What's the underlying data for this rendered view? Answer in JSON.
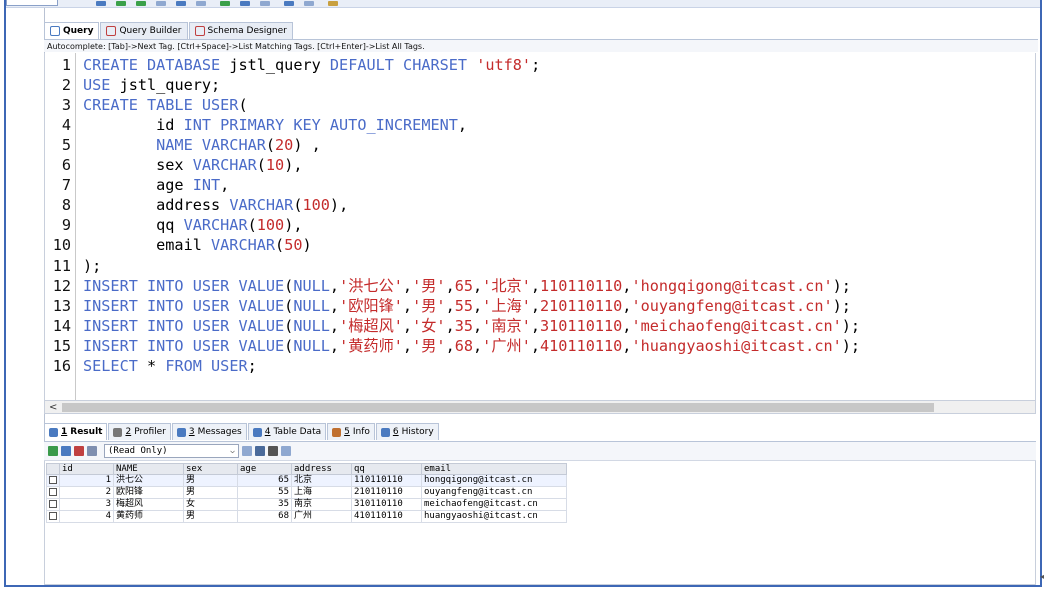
{
  "top_strip": {
    "db_selector_value": ""
  },
  "editor_tabs": [
    {
      "label": "Query",
      "icon": "query-icon",
      "active": true
    },
    {
      "label": "Query Builder",
      "icon": "query-builder-icon",
      "active": false
    },
    {
      "label": "Schema Designer",
      "icon": "schema-designer-icon",
      "active": false
    }
  ],
  "autocomplete_hint": "Autocomplete: [Tab]->Next Tag. [Ctrl+Space]->List Matching Tags. [Ctrl+Enter]->List All Tags.",
  "code_lines": [
    {
      "num": "1",
      "segments": [
        {
          "t": "kw",
          "v": "CREATE DATABASE "
        },
        {
          "t": "tx",
          "v": "jstl_query "
        },
        {
          "t": "kw",
          "v": "DEFAULT CHARSET "
        },
        {
          "t": "str",
          "v": "'utf8'"
        },
        {
          "t": "tx",
          "v": ";"
        }
      ]
    },
    {
      "num": "2",
      "segments": [
        {
          "t": "kw",
          "v": "USE "
        },
        {
          "t": "tx",
          "v": "jstl_query;"
        }
      ]
    },
    {
      "num": "3",
      "segments": [
        {
          "t": "kw",
          "v": "CREATE TABLE USER"
        },
        {
          "t": "tx",
          "v": "("
        }
      ]
    },
    {
      "num": "4",
      "segments": [
        {
          "t": "tx",
          "v": "        id "
        },
        {
          "t": "kw",
          "v": "INT PRIMARY KEY AUTO_INCREMENT"
        },
        {
          "t": "tx",
          "v": ","
        }
      ]
    },
    {
      "num": "5",
      "segments": [
        {
          "t": "kw",
          "v": "        NAME VARCHAR"
        },
        {
          "t": "tx",
          "v": "("
        },
        {
          "t": "str",
          "v": "20"
        },
        {
          "t": "tx",
          "v": ") ,"
        }
      ]
    },
    {
      "num": "6",
      "segments": [
        {
          "t": "tx",
          "v": "        sex "
        },
        {
          "t": "kw",
          "v": "VARCHAR"
        },
        {
          "t": "tx",
          "v": "("
        },
        {
          "t": "str",
          "v": "10"
        },
        {
          "t": "tx",
          "v": "),"
        }
      ]
    },
    {
      "num": "7",
      "segments": [
        {
          "t": "tx",
          "v": "        age "
        },
        {
          "t": "kw",
          "v": "INT"
        },
        {
          "t": "tx",
          "v": ","
        }
      ]
    },
    {
      "num": "8",
      "segments": [
        {
          "t": "tx",
          "v": "        address "
        },
        {
          "t": "kw",
          "v": "VARCHAR"
        },
        {
          "t": "tx",
          "v": "("
        },
        {
          "t": "str",
          "v": "100"
        },
        {
          "t": "tx",
          "v": "),"
        }
      ]
    },
    {
      "num": "9",
      "segments": [
        {
          "t": "tx",
          "v": "        qq "
        },
        {
          "t": "kw",
          "v": "VARCHAR"
        },
        {
          "t": "tx",
          "v": "("
        },
        {
          "t": "str",
          "v": "100"
        },
        {
          "t": "tx",
          "v": "),"
        }
      ]
    },
    {
      "num": "10",
      "segments": [
        {
          "t": "tx",
          "v": "        email "
        },
        {
          "t": "kw",
          "v": "VARCHAR"
        },
        {
          "t": "tx",
          "v": "("
        },
        {
          "t": "str",
          "v": "50"
        },
        {
          "t": "tx",
          "v": ")"
        }
      ]
    },
    {
      "num": "11",
      "segments": [
        {
          "t": "tx",
          "v": ");"
        }
      ]
    },
    {
      "num": "12",
      "segments": [
        {
          "t": "kw",
          "v": "INSERT INTO USER VALUE"
        },
        {
          "t": "tx",
          "v": "("
        },
        {
          "t": "kw",
          "v": "NULL"
        },
        {
          "t": "tx",
          "v": ","
        },
        {
          "t": "str",
          "v": "'洪七公'"
        },
        {
          "t": "tx",
          "v": ","
        },
        {
          "t": "str",
          "v": "'男'"
        },
        {
          "t": "tx",
          "v": ","
        },
        {
          "t": "str",
          "v": "65"
        },
        {
          "t": "tx",
          "v": ","
        },
        {
          "t": "str",
          "v": "'北京'"
        },
        {
          "t": "tx",
          "v": ","
        },
        {
          "t": "str",
          "v": "110110110"
        },
        {
          "t": "tx",
          "v": ","
        },
        {
          "t": "str",
          "v": "'hongqigong@itcast.cn'"
        },
        {
          "t": "tx",
          "v": ");"
        }
      ]
    },
    {
      "num": "13",
      "segments": [
        {
          "t": "kw",
          "v": "INSERT INTO USER VALUE"
        },
        {
          "t": "tx",
          "v": "("
        },
        {
          "t": "kw",
          "v": "NULL"
        },
        {
          "t": "tx",
          "v": ","
        },
        {
          "t": "str",
          "v": "'欧阳锋'"
        },
        {
          "t": "tx",
          "v": ","
        },
        {
          "t": "str",
          "v": "'男'"
        },
        {
          "t": "tx",
          "v": ","
        },
        {
          "t": "str",
          "v": "55"
        },
        {
          "t": "tx",
          "v": ","
        },
        {
          "t": "str",
          "v": "'上海'"
        },
        {
          "t": "tx",
          "v": ","
        },
        {
          "t": "str",
          "v": "210110110"
        },
        {
          "t": "tx",
          "v": ","
        },
        {
          "t": "str",
          "v": "'ouyangfeng@itcast.cn'"
        },
        {
          "t": "tx",
          "v": ");"
        }
      ]
    },
    {
      "num": "14",
      "segments": [
        {
          "t": "kw",
          "v": "INSERT INTO USER VALUE"
        },
        {
          "t": "tx",
          "v": "("
        },
        {
          "t": "kw",
          "v": "NULL"
        },
        {
          "t": "tx",
          "v": ","
        },
        {
          "t": "str",
          "v": "'梅超风'"
        },
        {
          "t": "tx",
          "v": ","
        },
        {
          "t": "str",
          "v": "'女'"
        },
        {
          "t": "tx",
          "v": ","
        },
        {
          "t": "str",
          "v": "35"
        },
        {
          "t": "tx",
          "v": ","
        },
        {
          "t": "str",
          "v": "'南京'"
        },
        {
          "t": "tx",
          "v": ","
        },
        {
          "t": "str",
          "v": "310110110"
        },
        {
          "t": "tx",
          "v": ","
        },
        {
          "t": "str",
          "v": "'meichaofeng@itcast.cn'"
        },
        {
          "t": "tx",
          "v": ");"
        }
      ]
    },
    {
      "num": "15",
      "segments": [
        {
          "t": "kw",
          "v": "INSERT INTO USER VALUE"
        },
        {
          "t": "tx",
          "v": "("
        },
        {
          "t": "kw",
          "v": "NULL"
        },
        {
          "t": "tx",
          "v": ","
        },
        {
          "t": "str",
          "v": "'黄药师'"
        },
        {
          "t": "tx",
          "v": ","
        },
        {
          "t": "str",
          "v": "'男'"
        },
        {
          "t": "tx",
          "v": ","
        },
        {
          "t": "str",
          "v": "68"
        },
        {
          "t": "tx",
          "v": ","
        },
        {
          "t": "str",
          "v": "'广州'"
        },
        {
          "t": "tx",
          "v": ","
        },
        {
          "t": "str",
          "v": "410110110"
        },
        {
          "t": "tx",
          "v": ","
        },
        {
          "t": "str",
          "v": "'huangyaoshi@itcast.cn'"
        },
        {
          "t": "tx",
          "v": ");"
        }
      ]
    },
    {
      "num": "16",
      "segments": [
        {
          "t": "kw",
          "v": "SELECT "
        },
        {
          "t": "tx",
          "v": "* "
        },
        {
          "t": "kw",
          "v": "FROM USER"
        },
        {
          "t": "tx",
          "v": ";"
        }
      ]
    }
  ],
  "hscroll_arrow": "<",
  "result_tabs": [
    {
      "num": "1",
      "label": "Result",
      "icon": "result-grid-icon",
      "active": true
    },
    {
      "num": "2",
      "label": "Profiler",
      "icon": "profiler-icon",
      "active": false
    },
    {
      "num": "3",
      "label": "Messages",
      "icon": "messages-icon",
      "active": false
    },
    {
      "num": "4",
      "label": "Table Data",
      "icon": "table-data-icon",
      "active": false
    },
    {
      "num": "5",
      "label": "Info",
      "icon": "info-icon",
      "active": false
    },
    {
      "num": "6",
      "label": "History",
      "icon": "history-icon",
      "active": false
    }
  ],
  "result_toolbar": {
    "mode": "(Read Only)"
  },
  "result_grid": {
    "columns": [
      "id",
      "NAME",
      "sex",
      "age",
      "address",
      "qq",
      "email"
    ],
    "rows": [
      [
        "1",
        "洪七公",
        "男",
        "65",
        "北京",
        "110110110",
        "hongqigong@itcast.cn"
      ],
      [
        "2",
        "欧阳锋",
        "男",
        "55",
        "上海",
        "210110110",
        "ouyangfeng@itcast.cn"
      ],
      [
        "3",
        "梅超风",
        "女",
        "35",
        "南京",
        "310110110",
        "meichaofeng@itcast.cn"
      ],
      [
        "4",
        "黄药师",
        "男",
        "68",
        "广州",
        "410110110",
        "huangyaoshi@itcast.cn"
      ]
    ]
  },
  "colors": {
    "keyword": "#4a6bc8",
    "string": "#c42b2b",
    "frame": "#3d67b5"
  }
}
